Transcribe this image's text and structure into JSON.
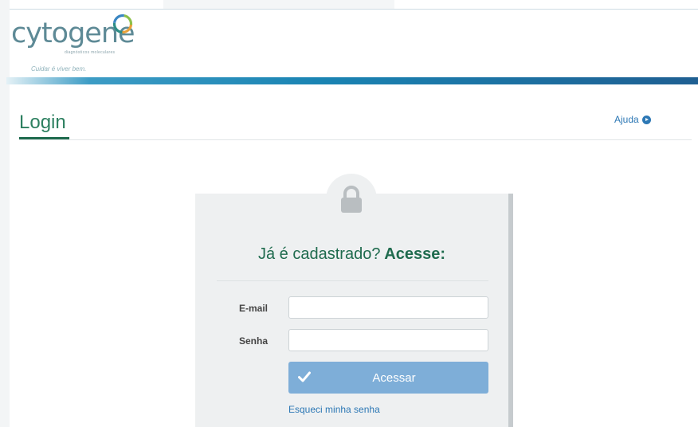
{
  "brand": {
    "logo_text": "cytogene",
    "logo_subtext": "diagnósticos moleculares",
    "tagline": "Cuidar é viver bem.",
    "ring_colors": [
      "#e8a13a",
      "#2e8d86",
      "#8cc04a",
      "#3a86c2"
    ]
  },
  "header": {
    "band_color": "#1a84b3"
  },
  "page": {
    "title": "Login",
    "help_label": "Ajuda",
    "help_icon": "arrow-circle-right-icon",
    "accent_color": "#1f6b4e"
  },
  "login": {
    "lock_icon": "lock-icon",
    "heading_prefix": "Já é cadastrado?",
    "heading_emphasis": "Acesse:",
    "email_label": "E-mail",
    "email_value": "",
    "password_label": "Senha",
    "password_value": "",
    "submit_icon": "check-icon",
    "submit_label": "Acessar",
    "submit_color": "#7eaed8",
    "forgot_label": "Esqueci minha senha"
  }
}
